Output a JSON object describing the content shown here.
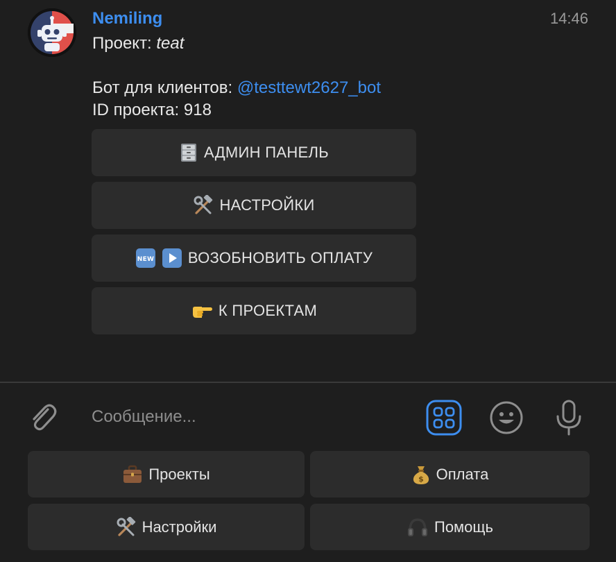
{
  "message": {
    "sender": "Nemiling",
    "time": "14:46",
    "project_label": "Проект: ",
    "project_name": "teat",
    "bot_label": "Бот для клиентов: ",
    "bot_username": "@testtewt2627_bot",
    "project_id_text": "ID проекта: 918"
  },
  "inline_buttons": [
    {
      "label": "АДМИН ПАНЕЛЬ",
      "icon": "file-cabinet-icon"
    },
    {
      "label": "НАСТРОЙКИ",
      "icon": "hammer-wrench-icon"
    },
    {
      "label": "ВОЗОБНОВИТЬ ОПЛАТУ",
      "icon": "new-badge-play-icon"
    },
    {
      "label": "К ПРОЕКТАМ",
      "icon": "pointing-hand-icon"
    }
  ],
  "composer": {
    "placeholder": "Сообщение..."
  },
  "reply_keyboard": [
    {
      "label": "Проекты",
      "icon": "briefcase-icon"
    },
    {
      "label": "Оплата",
      "icon": "money-bag-icon"
    },
    {
      "label": "Настройки",
      "icon": "hammer-wrench-icon"
    },
    {
      "label": "Помощь",
      "icon": "headphones-icon"
    }
  ],
  "colors": {
    "background": "#1e1e1e",
    "accent": "#3d8ef0",
    "button": "#2c2c2c",
    "avatar_red": "#e0504a"
  }
}
